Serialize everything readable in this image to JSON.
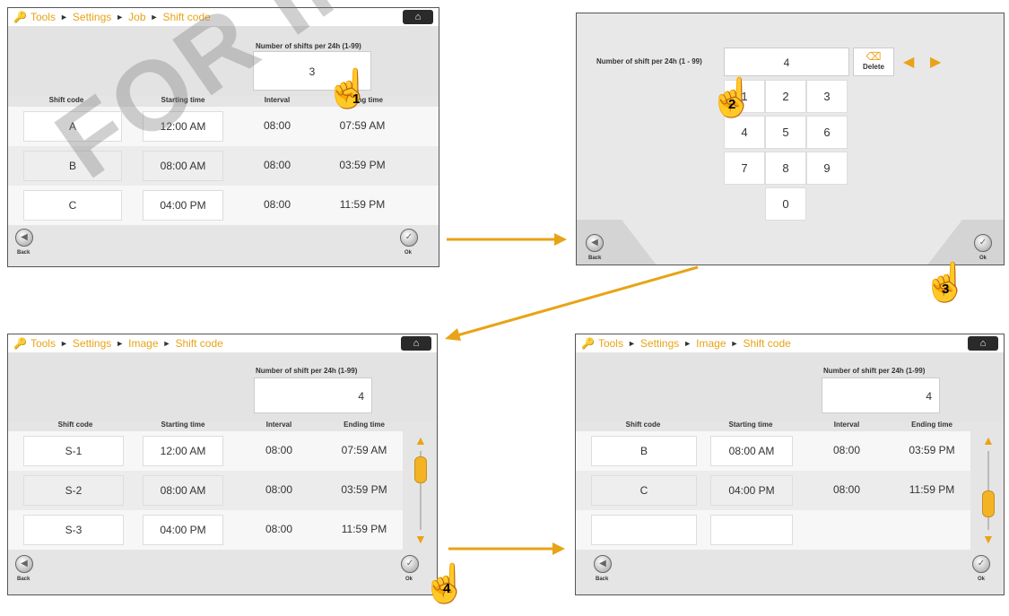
{
  "watermark": "FOR INFO",
  "bc_sep": "►",
  "panel1": {
    "breadcrumb": [
      "Tools",
      "Settings",
      "Job",
      "Shift code"
    ],
    "num_label": "Number of shifts per 24h (1-99)",
    "num_value": "3",
    "headers": [
      "Shift code",
      "Starting time",
      "Interval",
      "Ending time"
    ],
    "rows": [
      [
        "A",
        "12:00 AM",
        "08:00",
        "07:59 AM"
      ],
      [
        "B",
        "08:00 AM",
        "08:00",
        "03:59 PM"
      ],
      [
        "C",
        "04:00 PM",
        "08:00",
        "11:59 PM"
      ]
    ],
    "back": "Back",
    "ok": "Ok"
  },
  "panel2": {
    "num_label": "Number of shift per 24h (1 - 99)",
    "num_value": "4",
    "delete": "Delete",
    "keys": [
      "1",
      "2",
      "3",
      "4",
      "5",
      "6",
      "7",
      "8",
      "9",
      "0"
    ],
    "back": "Back",
    "ok": "Ok"
  },
  "panel3": {
    "breadcrumb": [
      "Tools",
      "Settings",
      "Image",
      "Shift code"
    ],
    "num_label": "Number of shift per 24h (1-99)",
    "num_value": "4",
    "headers": [
      "Shift code",
      "Starting time",
      "Interval",
      "Ending time"
    ],
    "rows": [
      [
        "S-1",
        "12:00 AM",
        "08:00",
        "07:59 AM"
      ],
      [
        "S-2",
        "08:00 AM",
        "08:00",
        "03:59 PM"
      ],
      [
        "S-3",
        "04:00 PM",
        "08:00",
        "11:59 PM"
      ]
    ],
    "back": "Back",
    "ok": "Ok"
  },
  "panel4": {
    "breadcrumb": [
      "Tools",
      "Settings",
      "Image",
      "Shift code"
    ],
    "num_label": "Number of shift per 24h (1-99)",
    "num_value": "4",
    "headers": [
      "Shift code",
      "Starting time",
      "Interval",
      "Ending time"
    ],
    "rows": [
      [
        "B",
        "08:00 AM",
        "08:00",
        "03:59 PM"
      ],
      [
        "C",
        "04:00 PM",
        "08:00",
        "11:59 PM"
      ]
    ],
    "back": "Back",
    "ok": "Ok"
  },
  "steps": [
    "1",
    "2",
    "3",
    "4"
  ],
  "colors": {
    "accent": "#e8a317",
    "hand": "#e53935"
  }
}
